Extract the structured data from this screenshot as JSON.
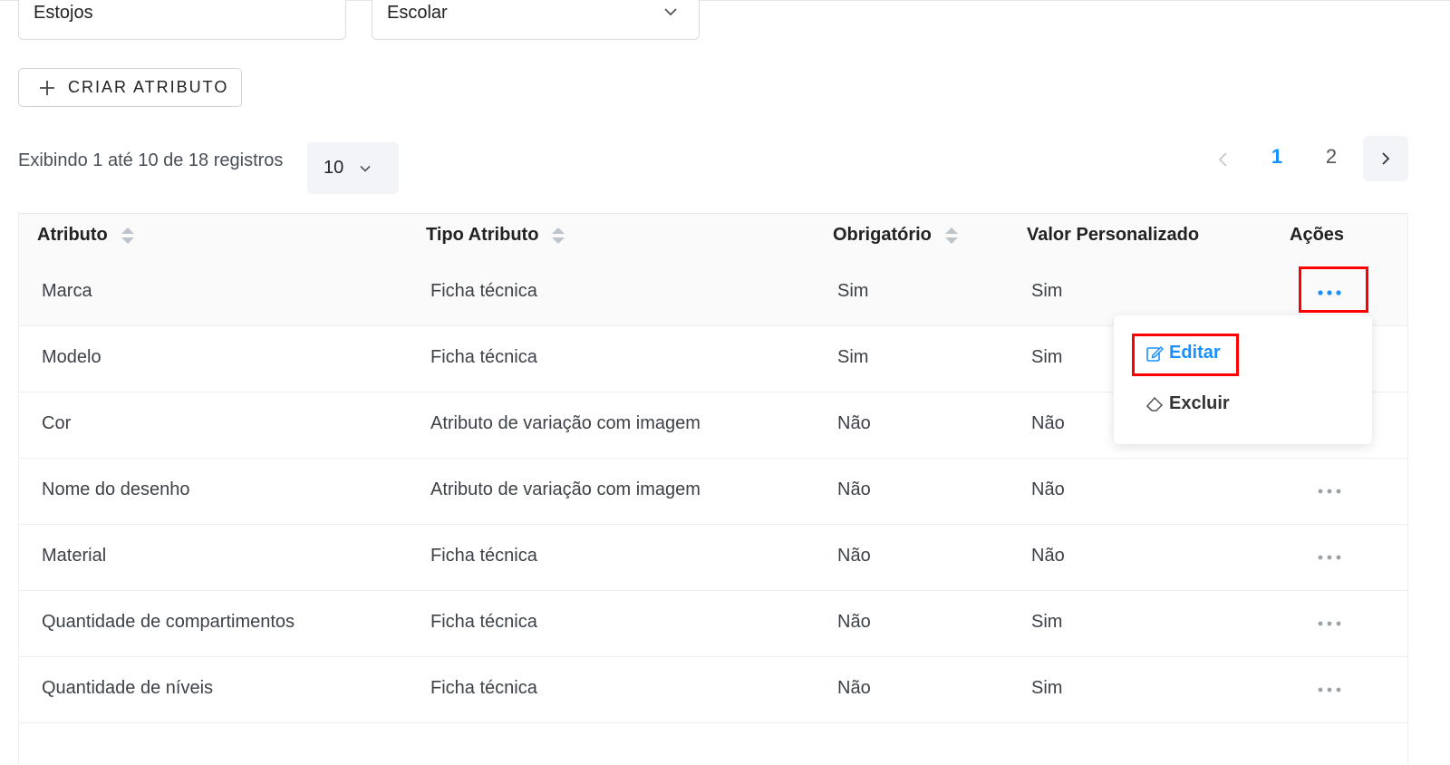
{
  "filters": {
    "category_value": "Estojos",
    "segment_value": "Escolar"
  },
  "toolbar": {
    "create_label": "CRIAR ATRIBUTO"
  },
  "pagination": {
    "summary": "Exibindo 1 até 10 de 18 registros",
    "page_size": "10",
    "pages": [
      "1",
      "2"
    ],
    "current_page": "1"
  },
  "table": {
    "headers": {
      "attribute": "Atributo",
      "type": "Tipo Atributo",
      "required": "Obrigatório",
      "custom_value": "Valor Personalizado",
      "actions": "Ações"
    },
    "rows": [
      [
        "Marca",
        "Ficha técnica",
        "Sim",
        "Sim"
      ],
      [
        "Modelo",
        "Ficha técnica",
        "Sim",
        "Sim"
      ],
      [
        "Cor",
        "Atributo de variação com imagem",
        "Não",
        "Não"
      ],
      [
        "Nome do desenho",
        "Atributo de variação com imagem",
        "Não",
        "Não"
      ],
      [
        "Material",
        "Ficha técnica",
        "Não",
        "Não"
      ],
      [
        "Quantidade de compartimentos",
        "Ficha técnica",
        "Não",
        "Sim"
      ],
      [
        "Quantidade de níveis",
        "Ficha técnica",
        "Não",
        "Sim"
      ]
    ]
  },
  "actions_menu": {
    "edit_label": "Editar",
    "delete_label": "Excluir"
  },
  "colors": {
    "primary": "#1890ff",
    "highlight": "#ff0000",
    "muted_icon": "#9aa0a8"
  },
  "icons": {
    "create": "plus-icon",
    "sort": "sort-icon",
    "more": "ellipsis-icon",
    "edit": "edit-icon",
    "delete": "eraser-icon"
  }
}
